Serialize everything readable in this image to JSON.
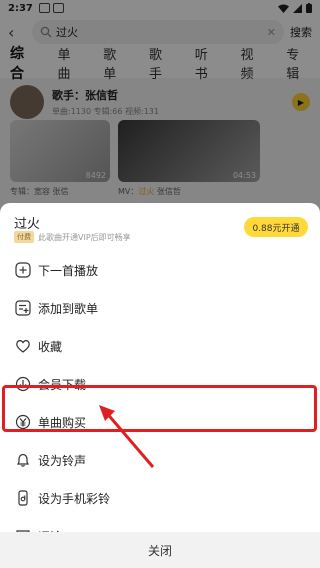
{
  "status_bar": {
    "time": "2:37"
  },
  "search": {
    "back_icon": "back-arrow-icon",
    "query": "过火",
    "clear_icon": "close-icon",
    "search_label": "搜索"
  },
  "tabs": [
    "综合",
    "单曲",
    "歌单",
    "歌手",
    "听书",
    "视频",
    "专辑"
  ],
  "artist": {
    "name": "歌手：张信哲",
    "meta": "单曲:1130  专辑:66  视频:131"
  },
  "cards": [
    {
      "count": "8492",
      "caption": "专辑：宽容 张信"
    },
    {
      "duration": "04:53",
      "caption_prefix": "MV：",
      "caption_highlight": "过火",
      "caption_suffix": " 张信哲"
    }
  ],
  "sheet": {
    "title": "过火",
    "paid_badge": "付费",
    "vip_note": "此歌曲开通VIP后即可畅享",
    "vip_button": "0.88元开通",
    "menu": [
      {
        "label": "下一首播放",
        "icon": "plus-icon"
      },
      {
        "label": "添加到歌单",
        "icon": "add-to-playlist-icon"
      },
      {
        "label": "收藏",
        "icon": "heart-icon"
      },
      {
        "label": "会员下载",
        "icon": "download-icon"
      },
      {
        "label": "单曲购买",
        "icon": "yen-icon"
      },
      {
        "label": "设为铃声",
        "icon": "bell-icon"
      },
      {
        "label": "设为手机彩铃",
        "icon": "phone-ringtone-icon"
      },
      {
        "label": "评论",
        "icon": "comment-icon"
      }
    ],
    "close_label": "关闭"
  },
  "colors": {
    "accent": "#ffd93a",
    "highlight": "#e02020"
  }
}
